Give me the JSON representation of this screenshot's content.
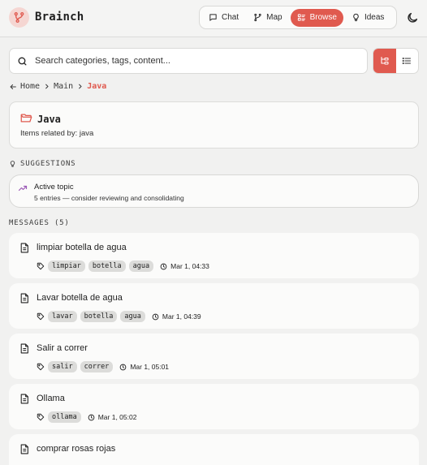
{
  "app": {
    "title": "Brainch"
  },
  "nav": [
    {
      "label": "Chat",
      "icon": "chat-icon",
      "active": false
    },
    {
      "label": "Map",
      "icon": "branch-icon",
      "active": false
    },
    {
      "label": "Browse",
      "icon": "browse-icon",
      "active": true
    },
    {
      "label": "Ideas",
      "icon": "lightbulb-icon",
      "active": false
    }
  ],
  "search": {
    "placeholder": "Search categories, tags, content..."
  },
  "breadcrumb": {
    "items": [
      "Home",
      "Main"
    ],
    "current": "Java"
  },
  "category": {
    "title": "Java",
    "description": "Items related by: java"
  },
  "suggestions": {
    "label": "SUGGESTIONS",
    "items": [
      {
        "title": "Active topic",
        "description": "5 entries — consider reviewing and consolidating"
      }
    ]
  },
  "messages": {
    "label": "MESSAGES (5)",
    "items": [
      {
        "title": "limpiar botella de agua",
        "tags": [
          "limpiar",
          "botella",
          "agua"
        ],
        "time": "Mar 1, 04:33"
      },
      {
        "title": "Lavar botella de agua",
        "tags": [
          "lavar",
          "botella",
          "agua"
        ],
        "time": "Mar 1, 04:39"
      },
      {
        "title": "Salir a correr",
        "tags": [
          "salir",
          "correr"
        ],
        "time": "Mar 1, 05:01"
      },
      {
        "title": "Ollama",
        "tags": [
          "ollama"
        ],
        "time": "Mar 1, 05:02"
      },
      {
        "title": "comprar rosas rojas",
        "tags": [],
        "time": ""
      }
    ]
  },
  "colors": {
    "accent": "#e05a4f",
    "background": "#f1f1f0",
    "card": "#fbfbfa",
    "tag": "#dcdcda"
  }
}
